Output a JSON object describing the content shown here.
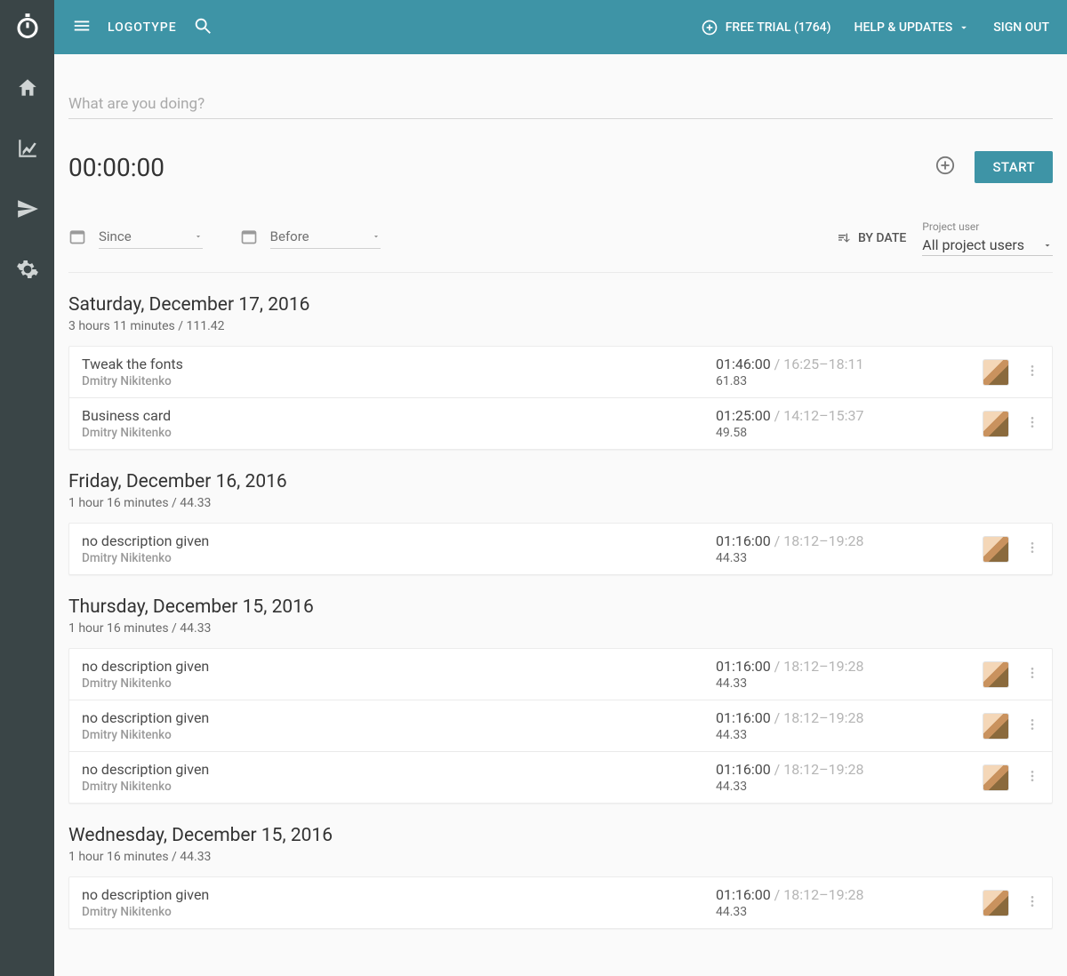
{
  "topbar": {
    "brand": "LOGOTYPE",
    "free_trial": "FREE TRIAL (1764)",
    "help_updates": "HELP & UPDATES",
    "sign_out": "SIGN OUT"
  },
  "input": {
    "placeholder": "What are you doing?"
  },
  "timer": {
    "display": "00:00:00",
    "start_label": "START"
  },
  "filters": {
    "since": "Since",
    "before": "Before",
    "sort_label": "BY DATE",
    "project_user_label": "Project user",
    "project_user_value": "All project users"
  },
  "days": [
    {
      "title": "Saturday, December 17, 2016",
      "summary": "3 hours 11 minutes / 111.42",
      "entries": [
        {
          "title": "Tweak the fonts",
          "user": "Dmitry Nikitenko",
          "duration": "01:46:00",
          "range": " / 16:25–18:11",
          "value": "61.83"
        },
        {
          "title": "Business card",
          "user": "Dmitry Nikitenko",
          "duration": "01:25:00",
          "range": " / 14:12–15:37",
          "value": "49.58"
        }
      ]
    },
    {
      "title": "Friday, December 16, 2016",
      "summary": "1 hour 16 minutes / 44.33",
      "entries": [
        {
          "title": "no description given",
          "user": "Dmitry Nikitenko",
          "duration": "01:16:00",
          "range": " / 18:12–19:28",
          "value": "44.33"
        }
      ]
    },
    {
      "title": "Thursday, December 15, 2016",
      "summary": "1 hour 16 minutes / 44.33",
      "entries": [
        {
          "title": "no description given",
          "user": "Dmitry Nikitenko",
          "duration": "01:16:00",
          "range": " / 18:12–19:28",
          "value": "44.33"
        },
        {
          "title": "no description given",
          "user": "Dmitry Nikitenko",
          "duration": "01:16:00",
          "range": " / 18:12–19:28",
          "value": "44.33"
        },
        {
          "title": "no description given",
          "user": "Dmitry Nikitenko",
          "duration": "01:16:00",
          "range": " / 18:12–19:28",
          "value": "44.33"
        }
      ]
    },
    {
      "title": "Wednesday, December 15, 2016",
      "summary": "1 hour 16 minutes / 44.33",
      "entries": [
        {
          "title": "no description given",
          "user": "Dmitry Nikitenko",
          "duration": "01:16:00",
          "range": " / 18:12–19:28",
          "value": "44.33"
        }
      ]
    }
  ]
}
